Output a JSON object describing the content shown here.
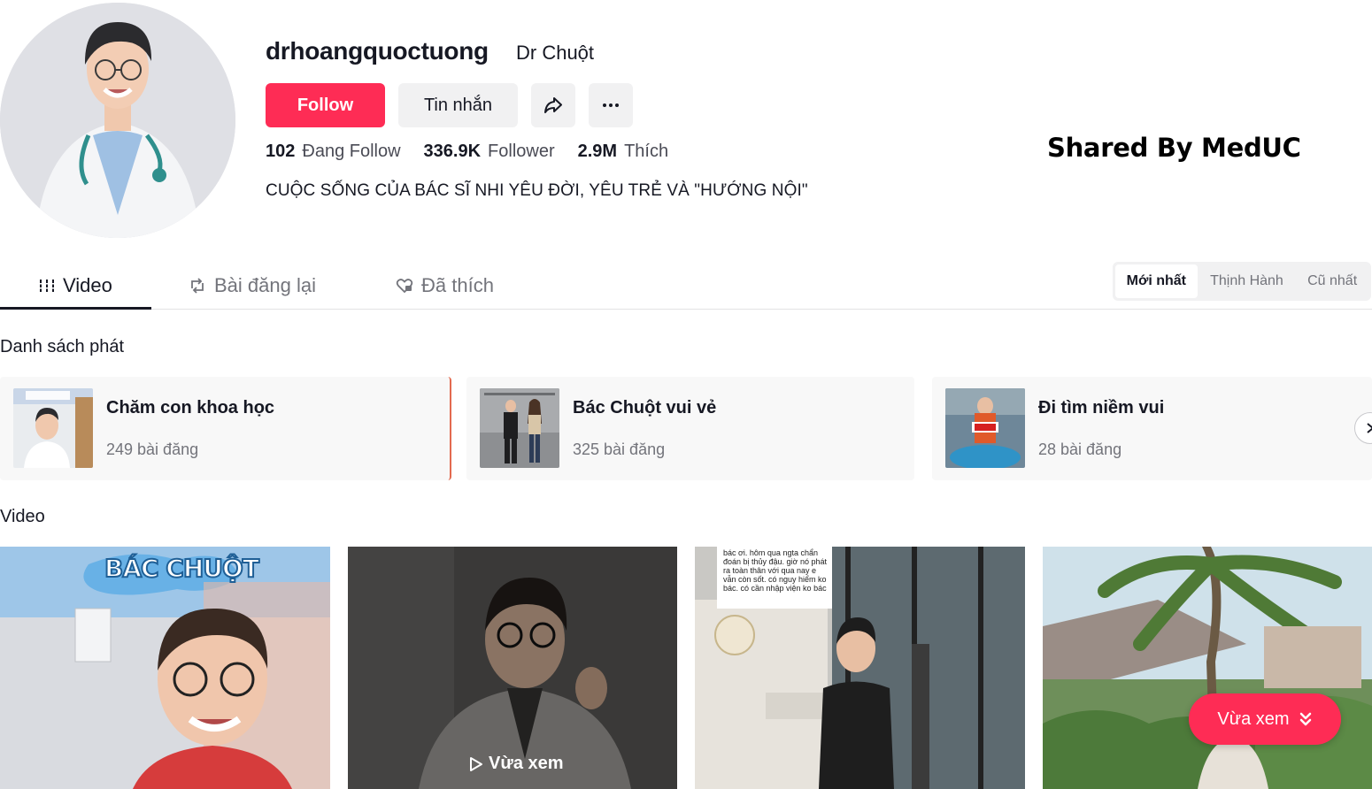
{
  "profile": {
    "username": "drhoangquoctuong",
    "nickname": "Dr Chuột",
    "bio": "CUỘC SỐNG CỦA BÁC SĨ NHI YÊU ĐỜI, YÊU TRẺ VÀ \"HƯỚNG NỘI\"",
    "following_count": "102",
    "following_label": "Đang Follow",
    "followers_count": "336.9K",
    "followers_label": "Follower",
    "likes_count": "2.9M",
    "likes_label": "Thích"
  },
  "actions": {
    "follow_label": "Follow",
    "message_label": "Tin nhắn",
    "share_icon": "share-icon",
    "more_icon": "more-icon"
  },
  "watermark": "Shared By MedUC",
  "tabs": [
    {
      "label": "Video",
      "icon": "grid-icon",
      "active": true
    },
    {
      "label": "Bài đăng lại",
      "icon": "repost-icon",
      "active": false
    },
    {
      "label": "Đã thích",
      "icon": "heart-lock-icon",
      "active": false
    }
  ],
  "sort": [
    {
      "label": "Mới nhất",
      "active": true
    },
    {
      "label": "Thịnh Hành",
      "active": false
    },
    {
      "label": "Cũ nhất",
      "active": false
    }
  ],
  "playlists_title": "Danh sách phát",
  "playlists": [
    {
      "name": "Chăm con khoa học",
      "count": "249 bài đăng"
    },
    {
      "name": "Bác Chuột vui vẻ",
      "count": "325 bài đăng"
    },
    {
      "name": "Đi tìm niềm vui",
      "count": "28 bài đăng"
    }
  ],
  "videos_title": "Video",
  "videos": [
    {
      "caption": "BÁC CHUỘT"
    },
    {
      "overlay": "Vừa xem"
    },
    {
      "caption": "bác ơi. hôm qua ngta chẩn đoán bị thủy đậu. giờ nó phát ra toàn thân với qua nay e vẫn còn sốt. có nguy hiểm ko bác. có cần nhập viện ko bác"
    },
    {
      "pill": "Vừa xem"
    }
  ],
  "colors": {
    "accent": "#fe2c55",
    "text": "#161823",
    "muted": "#73747b",
    "playlist_bg": "#f8f8f8"
  }
}
